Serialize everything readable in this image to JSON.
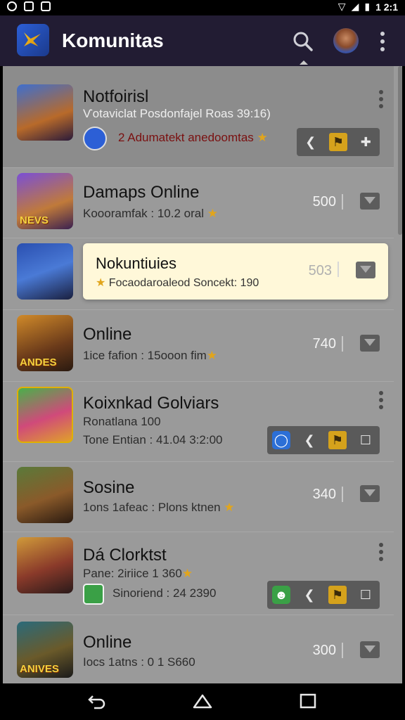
{
  "status": {
    "time": "1 2:1"
  },
  "header": {
    "title": "Komunitas"
  },
  "rows": [
    {
      "title": "Notfoirisl",
      "sub": "Ѵotaviclat Posdonfajel Roas 39:16)",
      "note": "2  Adumatekt anedoomtas",
      "type": "actions"
    },
    {
      "title": "Damaps Online",
      "sub": "Koooramfak : 10.2 oral",
      "score": "500",
      "badge": "NEVS",
      "type": "score"
    },
    {
      "title": "Nokuntiuies",
      "sub": "Focaodaroaleod Soncekt: 190",
      "score": "503",
      "type": "highlight"
    },
    {
      "title": "Online",
      "sub": "1ice fafion : 15ooon fim",
      "score": "740",
      "badge": "ANDES",
      "type": "score"
    },
    {
      "title": "Koixnkad Golviars",
      "sub": "Ronatlana 100",
      "sub2": "Tone Entian : 41.04 3:2:00",
      "type": "actions"
    },
    {
      "title": "Sosine",
      "sub": "1ons 1afeac : Plons ktnen",
      "score": "340",
      "type": "score"
    },
    {
      "title": "Dá Clorktst",
      "sub": "Pane: 2iriice 1 360",
      "sub2": "Sinoriend : 24 2390",
      "type": "actions"
    },
    {
      "title": "Online",
      "sub": "Iocs 1atns : 0 1 S660",
      "score": "300",
      "badge": "ANIVES",
      "type": "score"
    }
  ],
  "colors": {
    "appbar": "#221c33",
    "list_bg": "#9a9a9a",
    "highlight": "#fff8d9",
    "accent": "#d5a21c"
  }
}
